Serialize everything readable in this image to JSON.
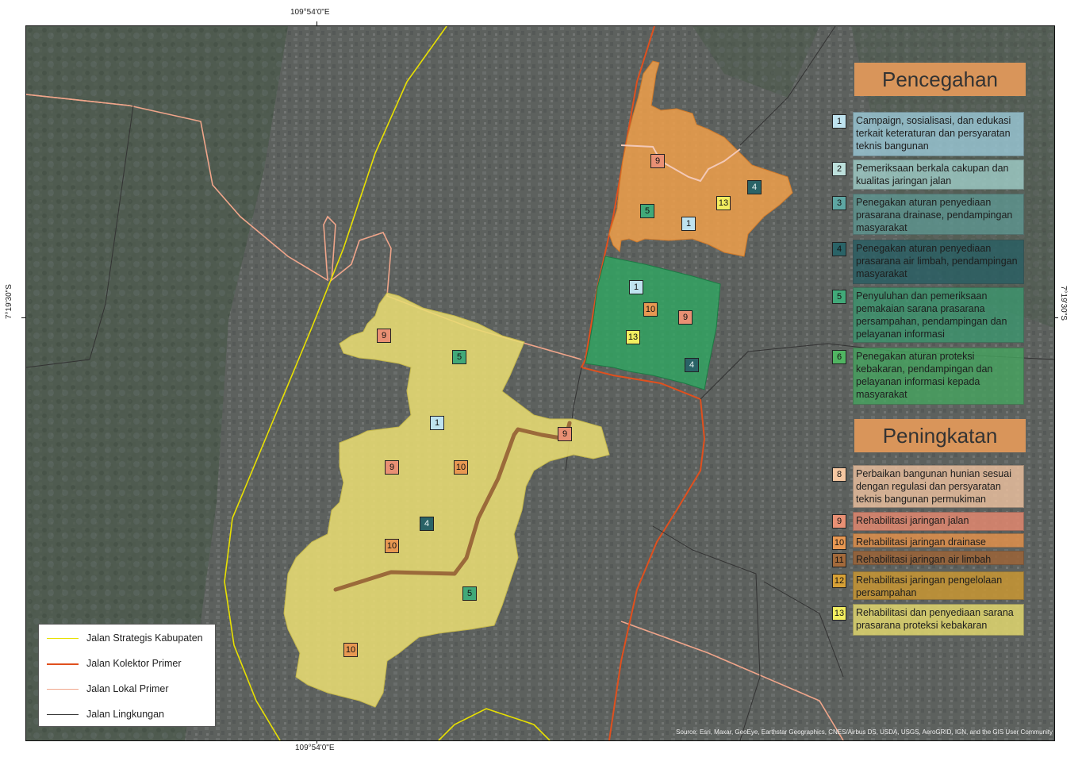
{
  "coordinates": {
    "top": "109°54'0\"E",
    "bottom": "109°54'0\"E",
    "left": "7°19'30\"S",
    "right": "7°19'30\"S"
  },
  "colors": {
    "legend_header": "#d9955a",
    "zone_yellow": "#e8dc73",
    "zone_orange": "#f0a04a",
    "zone_green": "#2fa761",
    "road_strategis": "#e8e000",
    "road_kolektor": "#e0501e",
    "road_lokal": "#f0a58a",
    "road_lingkungan": "#333333",
    "drainage_path": "#9b6a3a"
  },
  "legend": {
    "prevention_title": "Pencegahan",
    "improvement_title": "Peningkatan",
    "prevention_items": [
      {
        "num": "1",
        "text": "Campaign, sosialisasi, dan edukasi terkait keteraturan dan persyaratan teknis bangunan",
        "num_color": "#bfe3ef",
        "bg": "rgba(160,210,225,0.75)"
      },
      {
        "num": "2",
        "text": "Pemeriksaan berkala cakupan dan kualitas jaringan jalan",
        "num_color": "#bde0dc",
        "bg": "rgba(165,215,210,0.75)"
      },
      {
        "num": "3",
        "text": "Penegakan aturan penyediaan prasarana drainase, pendampingan masyarakat",
        "num_color": "#5ea6a3",
        "bg": "rgba(95,155,150,0.75)"
      },
      {
        "num": "4",
        "text": "Penegakan aturan penyediaan prasarana air limbah, pendampingan masyarakat",
        "num_color": "#2a6367",
        "bg": "rgba(40,95,100,0.8)"
      },
      {
        "num": "5",
        "text": "Penyuluhan dan pemeriksaan pemakaian sarana prasarana persampahan, pendampingan dan pelayanan informasi",
        "num_color": "#41a979",
        "bg": "rgba(60,150,110,0.8)"
      },
      {
        "num": "6",
        "text": "Penegakan aturan proteksi kebakaran, pendampingan dan pelayanan informasi kepada masyarakat",
        "num_color": "#50b562",
        "bg": "rgba(70,165,95,0.8)"
      }
    ],
    "improvement_items": [
      {
        "num": "8",
        "text": "Perbaikan bangunan hunian sesuai dengan regulasi dan persyaratan teknis bangunan permukiman",
        "num_color": "#f6c8a2",
        "bg": "rgba(240,195,160,0.8)"
      },
      {
        "num": "9",
        "text": "Rehabilitasi jaringan jalan",
        "num_color": "#e99074",
        "bg": "rgba(225,135,110,0.85)"
      },
      {
        "num": "10",
        "text": "Rehabilitasi jaringan drainase",
        "num_color": "#e89852",
        "bg": "rgba(225,145,75,0.85)"
      },
      {
        "num": "11",
        "text": "Rehabilitasi jaringan air limbah",
        "num_color": "#a36a3b",
        "bg": "rgba(155,100,55,0.85)"
      },
      {
        "num": "12",
        "text": "Rehabilitasi jaringan pengelolaan persampahan",
        "num_color": "#d7a136",
        "bg": "rgba(200,150,50,0.85)"
      },
      {
        "num": "13",
        "text": "Rehabilitasi dan penyediaan sarana prasarana proteksi kebakaran",
        "num_color": "#f3ee60",
        "bg": "rgba(225,215,110,0.85)"
      }
    ]
  },
  "road_legend": [
    {
      "label": "Jalan Strategis Kabupaten",
      "color": "#e8e000"
    },
    {
      "label": "Jalan Kolektor Primer",
      "color": "#e0501e"
    },
    {
      "label": "Jalan Lokal Primer",
      "color": "#f0a58a"
    },
    {
      "label": "Jalan Lingkungan",
      "color": "#333333"
    }
  ],
  "map_labels": {
    "orange": [
      "9",
      "4",
      "5",
      "13",
      "1"
    ],
    "green": [
      "1",
      "10",
      "9",
      "13",
      "4"
    ],
    "yellow": [
      "9",
      "5",
      "1",
      "9",
      "9",
      "10",
      "4",
      "10",
      "5",
      "10"
    ]
  },
  "attribution": "Source: Esri, Maxar, GeoEye, Earthstar Geographics, CNES/Airbus DS, USDA, USGS, AeroGRID, IGN, and the GIS User Community"
}
